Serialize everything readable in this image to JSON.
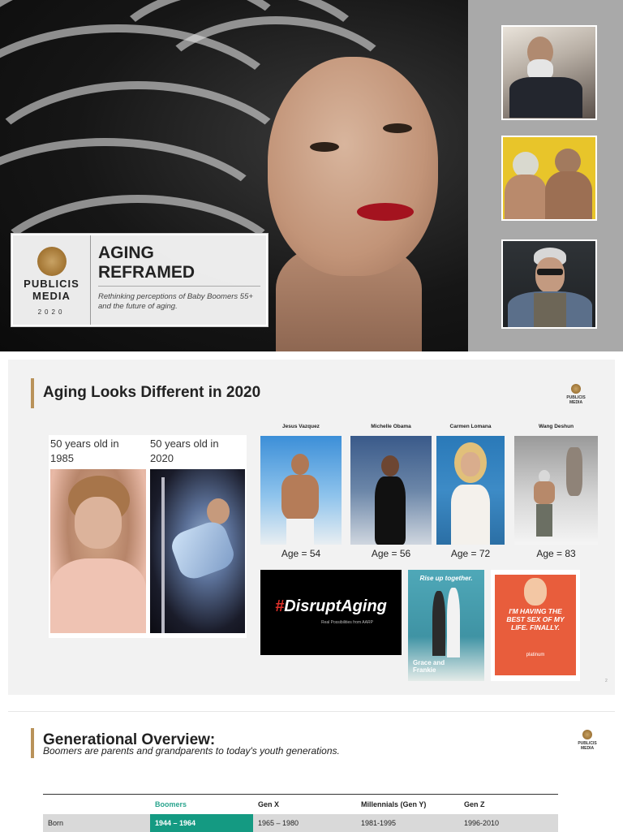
{
  "slide1": {
    "logo": {
      "name": "PUBLICIS\nMEDIA",
      "year": "2020"
    },
    "title": "AGING REFRAMED",
    "subtitle": "Rethinking perceptions of Baby Boomers 55+ and the future of aging."
  },
  "slide2": {
    "title": "Aging Looks Different in 2020",
    "logo": "PUBLICIS MEDIA",
    "compare": [
      {
        "label": "50 years old in 1985"
      },
      {
        "label": "50 years old in 2020"
      }
    ],
    "celebrities": [
      {
        "name": "Jesus Vazquez",
        "age": "Age = 54"
      },
      {
        "name": "Michelle Obama",
        "age": "Age = 56"
      },
      {
        "name": "Carmen Lomana",
        "age": "Age = 72"
      },
      {
        "name": "Wang Deshun",
        "age": "Age = 83"
      }
    ],
    "disrupt": {
      "hashtag": "#",
      "text": "DisruptAging",
      "small": "Real Possibilities from AARP"
    },
    "grace": {
      "top": "Rise up together.",
      "bottom": "Grace and\nFrankie"
    },
    "platinum": {
      "quote": "I'M HAVING THE BEST SEX OF MY LIFE. FINALLY.",
      "sub": "platinum"
    },
    "page_number": "2"
  },
  "slide3": {
    "title": "Generational Overview:",
    "subtitle": "Boomers are parents and grandparents to today's youth generations.",
    "logo": "PUBLICIS MEDIA",
    "table": {
      "headers": [
        "",
        "Boomers",
        "Gen X",
        "Millennials (Gen Y)",
        "Gen Z"
      ],
      "rows": [
        [
          "Born",
          "1944 – 1964",
          "1965 – 1980",
          "1981-1995",
          "1996-2010"
        ]
      ]
    }
  },
  "colors": {
    "accent_gold": "#b9925a",
    "boomers_teal": "#149a82",
    "lips_red": "#a4131f"
  }
}
